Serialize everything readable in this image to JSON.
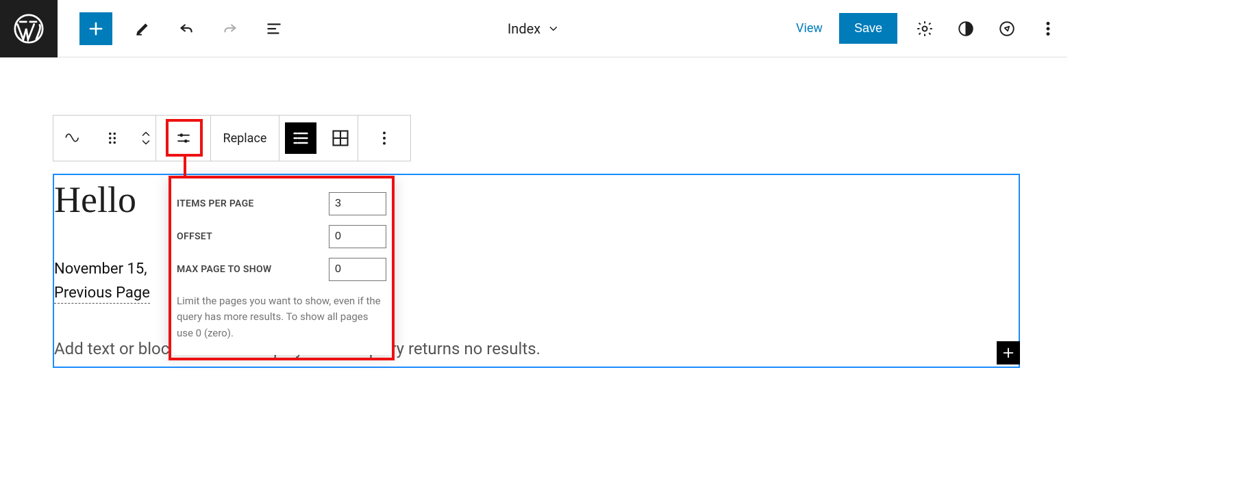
{
  "topbar": {
    "template_label": "Index",
    "view_label": "View",
    "save_label": "Save"
  },
  "block_toolbar": {
    "replace_label": "Replace"
  },
  "popover": {
    "items_label": "ITEMS PER PAGE",
    "items_value": "3",
    "offset_label": "OFFSET",
    "offset_value": "0",
    "max_label": "MAX PAGE TO SHOW",
    "max_value": "0",
    "help_text": "Limit the pages you want to show, even if the query has more results. To show all pages use 0 (zero)."
  },
  "content": {
    "title": "Hello",
    "date": "November 15,",
    "prev_page": "Previous Page",
    "placeholder": "Add text or blocks that will display when a query returns no results."
  }
}
